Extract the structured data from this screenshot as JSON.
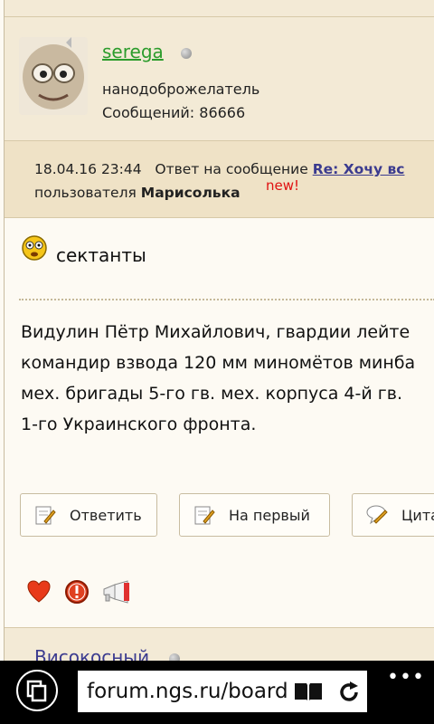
{
  "author": {
    "username": "serega",
    "title": "нанодоброжелатель",
    "post_count": "Сообщений: 86666"
  },
  "meta": {
    "datetime": "18.04.16 23:44",
    "reply_prefix": "Ответ на сообщение",
    "reply_link": "Re: Хочу вс",
    "user_prefix": "пользователя",
    "user": "Марисолька",
    "new_badge": "new!"
  },
  "post": {
    "subject": "сектанты",
    "body_lines": [
      "Видулин Пётр Михайлович, гвардии лейте",
      "командир взвода 120 мм миномётов минба",
      "мех. бригады 5-го гв. мех. корпуса 4-й гв.",
      "1-го Украинского фронта."
    ]
  },
  "actions": {
    "reply": "Ответить",
    "to_first": "На первый",
    "quote": "Цита"
  },
  "next_post": {
    "username": "Високосный"
  },
  "browser": {
    "url": "forum.ngs.ru/board"
  },
  "colors": {
    "link_green": "#2c9c2c",
    "link_blue": "#3b3b8f",
    "new_red": "#e01010"
  }
}
